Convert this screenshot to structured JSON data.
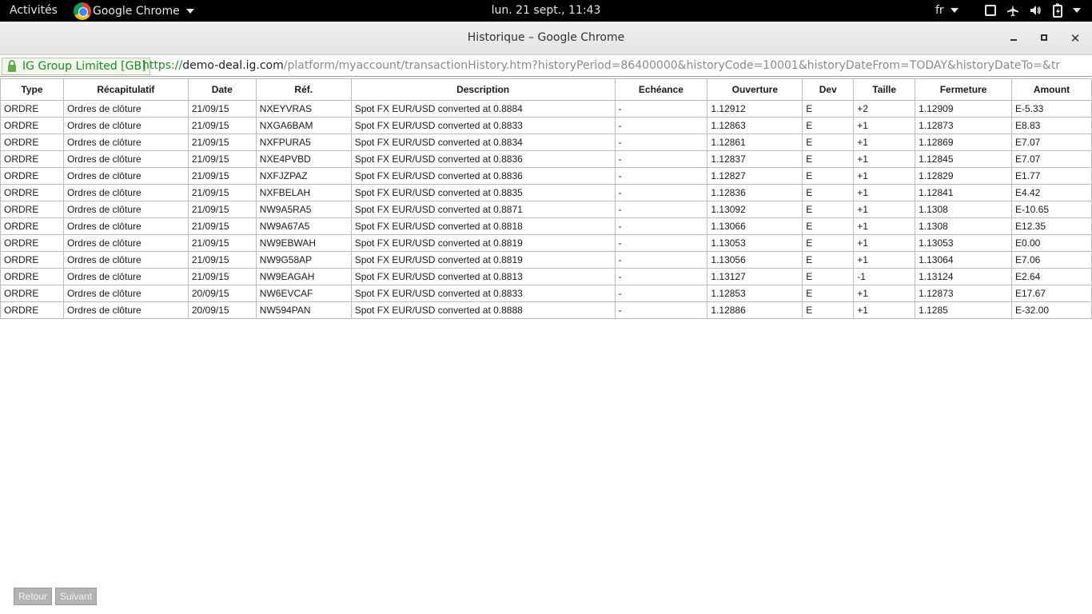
{
  "topbar": {
    "activities": "Activités",
    "app_name": "Google Chrome",
    "clock": "lun. 21 sept., 11:43",
    "language": "fr",
    "tray_icons": [
      "window-icon",
      "airplane-icon",
      "volume-icon",
      "battery-icon"
    ]
  },
  "window": {
    "title": "Historique – Google Chrome",
    "close_glyph": "✕"
  },
  "addressbar": {
    "ev_label": "IG Group Limited [GB]",
    "scheme": "https://",
    "host": "demo-deal.ig.com",
    "path": "/platform/myaccount/transactionHistory.htm?historyPeriod=86400000&historyCode=10001&historyDateFrom=TODAY&historyDateTo=&tr"
  },
  "table": {
    "headers": [
      "Type",
      "Récapitulatif",
      "Date",
      "Réf.",
      "Description",
      "Echéance",
      "Ouverture",
      "Dev",
      "Taille",
      "Fermeture",
      "Amount"
    ],
    "rows": [
      [
        "ORDRE",
        "Ordres de clôture",
        "21/09/15",
        "NXEYVRAS",
        "Spot FX EUR/USD converted at 0.8884",
        "-",
        "1.12912",
        "E",
        "+2",
        "1.12909",
        "E-5.33"
      ],
      [
        "ORDRE",
        "Ordres de clôture",
        "21/09/15",
        "NXGA6BAM",
        "Spot FX EUR/USD converted at 0.8833",
        "-",
        "1.12863",
        "E",
        "+1",
        "1.12873",
        "E8.83"
      ],
      [
        "ORDRE",
        "Ordres de clôture",
        "21/09/15",
        "NXFPURA5",
        "Spot FX EUR/USD converted at 0.8834",
        "-",
        "1.12861",
        "E",
        "+1",
        "1.12869",
        "E7.07"
      ],
      [
        "ORDRE",
        "Ordres de clôture",
        "21/09/15",
        "NXE4PVBD",
        "Spot FX EUR/USD converted at 0.8836",
        "-",
        "1.12837",
        "E",
        "+1",
        "1.12845",
        "E7.07"
      ],
      [
        "ORDRE",
        "Ordres de clôture",
        "21/09/15",
        "NXFJZPAZ",
        "Spot FX EUR/USD converted at 0.8836",
        "-",
        "1.12827",
        "E",
        "+1",
        "1.12829",
        "E1.77"
      ],
      [
        "ORDRE",
        "Ordres de clôture",
        "21/09/15",
        "NXFBELAH",
        "Spot FX EUR/USD converted at 0.8835",
        "-",
        "1.12836",
        "E",
        "+1",
        "1.12841",
        "E4.42"
      ],
      [
        "ORDRE",
        "Ordres de clôture",
        "21/09/15",
        "NW9A5RA5",
        "Spot FX EUR/USD converted at 0.8871",
        "-",
        "1.13092",
        "E",
        "+1",
        "1.1308",
        "E-10.65"
      ],
      [
        "ORDRE",
        "Ordres de clôture",
        "21/09/15",
        "NW9A67A5",
        "Spot FX EUR/USD converted at 0.8818",
        "-",
        "1.13066",
        "E",
        "+1",
        "1.1308",
        "E12.35"
      ],
      [
        "ORDRE",
        "Ordres de clôture",
        "21/09/15",
        "NW9EBWAH",
        "Spot FX EUR/USD converted at 0.8819",
        "-",
        "1.13053",
        "E",
        "+1",
        "1.13053",
        "E0.00"
      ],
      [
        "ORDRE",
        "Ordres de clôture",
        "21/09/15",
        "NW9G58AP",
        "Spot FX EUR/USD converted at 0.8819",
        "-",
        "1.13056",
        "E",
        "+1",
        "1.13064",
        "E7.06"
      ],
      [
        "ORDRE",
        "Ordres de clôture",
        "21/09/15",
        "NW9EAGAH",
        "Spot FX EUR/USD converted at 0.8813",
        "-",
        "1.13127",
        "E",
        "-1",
        "1.13124",
        "E2.64"
      ],
      [
        "ORDRE",
        "Ordres de clôture",
        "20/09/15",
        "NW6EVCAF",
        "Spot FX EUR/USD converted at 0.8833",
        "-",
        "1.12853",
        "E",
        "+1",
        "1.12873",
        "E17.67"
      ],
      [
        "ORDRE",
        "Ordres de clôture",
        "20/09/15",
        "NW594PAN",
        "Spot FX EUR/USD converted at 0.8888",
        "-",
        "1.12886",
        "E",
        "+1",
        "1.1285",
        "E-32.00"
      ]
    ]
  },
  "pager": {
    "back_label": "Retour",
    "next_label": "Suivant"
  },
  "colors": {
    "topbar_bg": "#000000",
    "secure_green": "#1d8a27",
    "pager_button_bg": "#b3b3b3"
  }
}
